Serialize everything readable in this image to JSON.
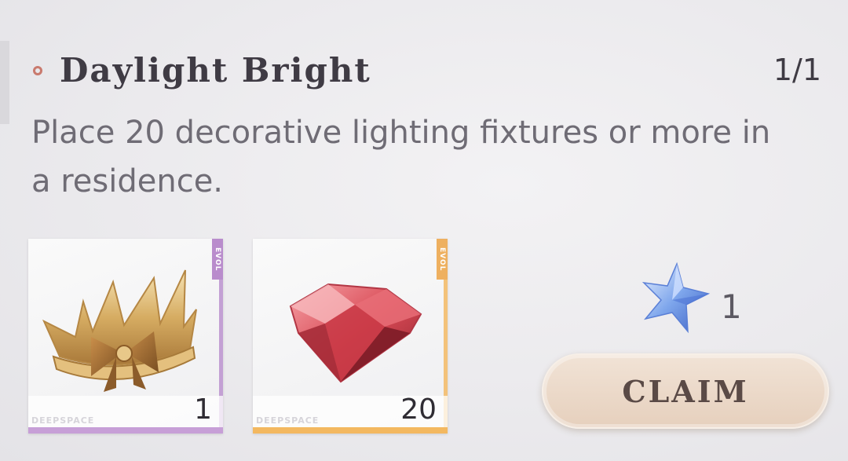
{
  "quest": {
    "title": "Daylight Bright",
    "progress": "1/1",
    "description": "Place 20 decorative lighting fixtures or more in a residence."
  },
  "rewards": [
    {
      "item": "crown-icon",
      "quantity": "1",
      "rarity_tag": "EVOL",
      "brand": "DEEPSPACE",
      "rarity_color": "#c79fd7"
    },
    {
      "item": "red-gem-icon",
      "quantity": "20",
      "rarity_tag": "EVOL",
      "brand": "DEEPSPACE",
      "rarity_color": "#f3b860"
    }
  ],
  "bonus": {
    "icon": "blue-star-icon",
    "count": "1"
  },
  "actions": {
    "claim_label": "CLAIM"
  },
  "colors": {
    "accent_ring": "#c97a6e",
    "title": "#3f3b44",
    "button": "#e9d6c5"
  }
}
